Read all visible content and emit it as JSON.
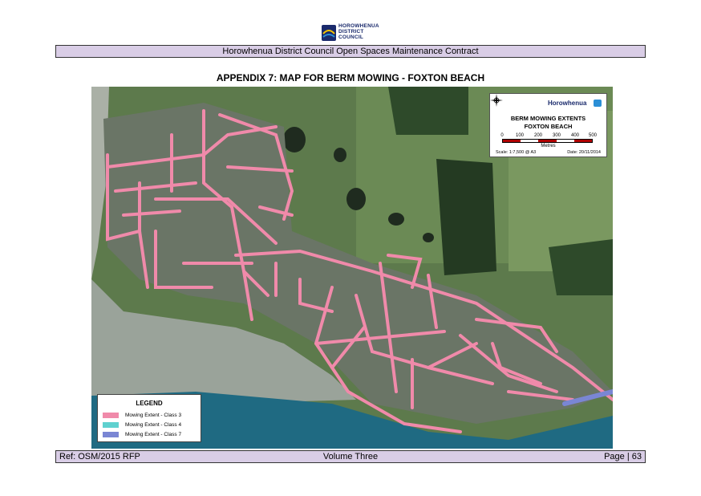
{
  "logo": {
    "lines": [
      "HOROWHENUA",
      "DISTRICT",
      "COUNCIL"
    ]
  },
  "header": {
    "title": "Horowhenua District Council Open Spaces Maintenance Contract"
  },
  "appendix_title": "APPENDIX 7:    MAP FOR BERM MOWING - FOXTON BEACH",
  "map": {
    "title_box": {
      "brand": "Horowhenua",
      "title_line1": "BERM MOWING EXTENTS",
      "title_line2": "FOXTON BEACH",
      "scale_labels": [
        "0",
        "100",
        "200",
        "300",
        "400",
        "500"
      ],
      "scale_unit": "Metres",
      "scale": "Scale: 1:7,500 @ A3",
      "date": "Date: 20/11/2014"
    },
    "legend": {
      "title": "LEGEND",
      "items": [
        {
          "label": "Mowing Extent - Class 3",
          "color": "#f08aaa"
        },
        {
          "label": "Mowing Extent - Class 4",
          "color": "#5fd1cf"
        },
        {
          "label": "Mowing Extent - Class 7",
          "color": "#7a86d4"
        }
      ]
    },
    "colors": {
      "berm": "#f08aaa",
      "class7": "#7a86d4",
      "sea": "#1f6a82",
      "sand": "#9aa39a",
      "farmland": "#5d7a4c",
      "forest": "#243a22",
      "urban": "#6a7566"
    }
  },
  "footer": {
    "ref": "Ref: OSM/2015 RFP",
    "volume": "Volume Three",
    "page": "Page | 63"
  }
}
